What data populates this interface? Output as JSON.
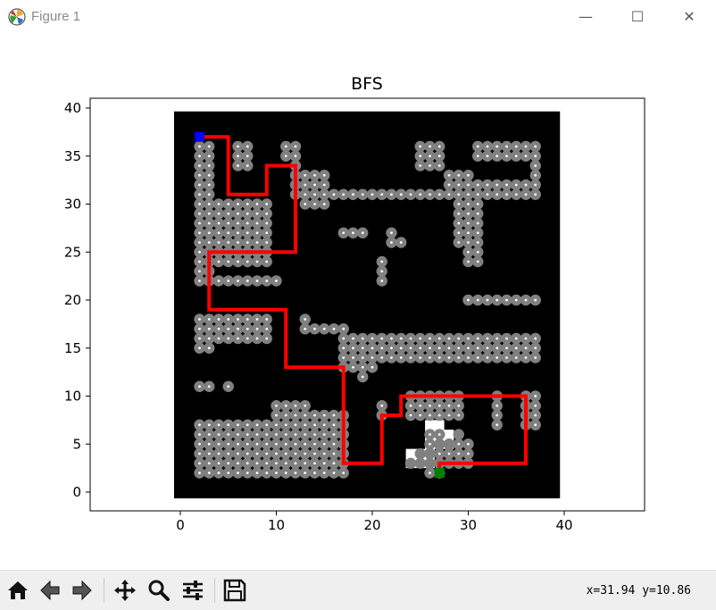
{
  "window": {
    "title": "Figure 1",
    "minimize_glyph": "—",
    "maximize_glyph": "☐",
    "close_glyph": "✕"
  },
  "toolbar": {
    "tools": [
      {
        "name": "home-icon"
      },
      {
        "name": "back-icon"
      },
      {
        "name": "forward-icon"
      },
      {
        "name": "pan-icon"
      },
      {
        "name": "zoom-icon"
      },
      {
        "name": "configure-subplots-icon"
      },
      {
        "name": "save-icon"
      }
    ],
    "coords_text": "x=31.94 y=10.86"
  },
  "chart_data": {
    "type": "scatter",
    "title": "BFS",
    "xlim": [
      -9,
      48
    ],
    "ylim": [
      -2,
      41
    ],
    "xticks": [
      0,
      10,
      20,
      30,
      40
    ],
    "yticks": [
      0,
      5,
      10,
      15,
      20,
      25,
      30,
      35,
      40
    ],
    "grid": false,
    "maze_bounds": {
      "x": [
        0,
        39
      ],
      "y": [
        0,
        39
      ]
    },
    "maze_walls": [
      [
        0,
        0,
        40,
        2
      ],
      [
        0,
        38,
        40,
        2
      ],
      [
        0,
        0,
        2,
        40
      ],
      [
        38,
        0,
        2,
        40
      ],
      [
        4,
        31,
        2,
        7
      ],
      [
        8,
        31,
        2,
        4
      ],
      [
        10,
        26,
        2,
        9
      ],
      [
        13,
        34,
        12,
        3
      ],
      [
        16,
        32,
        12,
        2
      ],
      [
        28,
        34,
        3,
        5
      ],
      [
        31,
        33,
        6,
        2
      ],
      [
        11,
        22,
        5,
        8
      ],
      [
        16,
        28,
        8,
        3
      ],
      [
        20,
        25,
        2,
        6
      ],
      [
        24,
        25,
        5,
        6
      ],
      [
        23,
        27,
        4,
        3
      ],
      [
        32,
        21,
        5,
        7
      ],
      [
        2,
        19,
        17,
        3
      ],
      [
        14,
        18,
        4,
        8
      ],
      [
        10,
        14,
        3,
        7
      ],
      [
        11,
        12,
        6,
        5
      ],
      [
        16,
        22,
        5,
        5
      ],
      [
        18,
        17,
        7,
        5
      ],
      [
        22,
        19,
        8,
        7
      ],
      [
        25,
        17,
        14,
        3
      ],
      [
        2,
        12,
        4,
        3
      ],
      [
        6,
        11,
        2,
        2
      ],
      [
        9,
        10,
        10,
        3
      ],
      [
        2,
        8,
        8,
        3
      ],
      [
        14,
        9,
        5,
        2
      ],
      [
        18,
        2,
        3,
        10
      ],
      [
        20,
        10,
        3,
        3
      ],
      [
        22,
        7,
        2,
        4
      ],
      [
        23,
        11,
        16,
        2
      ],
      [
        30,
        6,
        3,
        5
      ],
      [
        34,
        6,
        2,
        5
      ],
      [
        21,
        2,
        5,
        5
      ],
      [
        33,
        3,
        5,
        4
      ]
    ],
    "visited_points": [
      [
        2,
        3,
        2,
        36
      ],
      [
        6,
        7,
        34,
        36
      ],
      [
        8,
        9,
        31,
        34
      ],
      [
        11,
        13,
        34,
        36
      ],
      [
        16,
        28,
        35,
        36
      ],
      [
        31,
        37,
        35,
        36
      ],
      [
        11,
        22,
        31,
        33
      ],
      [
        23,
        37,
        31,
        34
      ],
      [
        2,
        9,
        24,
        30
      ],
      [
        13,
        15,
        25,
        30
      ],
      [
        17,
        20,
        24,
        27
      ],
      [
        22,
        31,
        24,
        30
      ],
      [
        16,
        21,
        22,
        24
      ],
      [
        3,
        13,
        16,
        22
      ],
      [
        12,
        20,
        12,
        20
      ],
      [
        19,
        37,
        14,
        18
      ],
      [
        21,
        24,
        17,
        20
      ],
      [
        26,
        37,
        18,
        20
      ],
      [
        2,
        8,
        2,
        10
      ],
      [
        9,
        17,
        2,
        12
      ],
      [
        5,
        7,
        10,
        11
      ],
      [
        19,
        22,
        8,
        12
      ],
      [
        24,
        31,
        8,
        12
      ],
      [
        24,
        30,
        3,
        5
      ],
      [
        31,
        37,
        7,
        11
      ],
      [
        22,
        27,
        2,
        6
      ],
      [
        36,
        37,
        3,
        7
      ]
    ],
    "frontier_points": [
      [
        25,
        4
      ],
      [
        26,
        4
      ],
      [
        27,
        5
      ],
      [
        28,
        5
      ],
      [
        29,
        6
      ],
      [
        24,
        3
      ],
      [
        25,
        3
      ],
      [
        26,
        3
      ],
      [
        27,
        3
      ]
    ],
    "unexplored_open": [
      [
        24,
        3,
        3,
        2
      ],
      [
        26,
        5,
        3,
        2
      ],
      [
        26,
        7,
        2,
        1
      ]
    ],
    "path": [
      [
        2,
        37
      ],
      [
        5,
        37
      ],
      [
        5,
        31
      ],
      [
        9,
        31
      ],
      [
        9,
        34
      ],
      [
        12,
        34
      ],
      [
        12,
        25
      ],
      [
        3,
        25
      ],
      [
        3,
        19
      ],
      [
        11,
        19
      ],
      [
        11,
        13
      ],
      [
        17,
        13
      ],
      [
        17,
        3
      ],
      [
        21,
        3
      ],
      [
        21,
        8
      ],
      [
        23,
        8
      ],
      [
        23,
        10
      ],
      [
        36,
        10
      ],
      [
        36,
        3
      ],
      [
        27,
        3
      ],
      [
        27,
        2
      ]
    ],
    "start": [
      2,
      37
    ],
    "goal": [
      27,
      2
    ]
  },
  "colors": {
    "wall": "#000000",
    "visited": "#808080",
    "visited_center": "#ffffff",
    "path": "#ff0000",
    "start": "#0000ff",
    "goal": "#008000"
  }
}
